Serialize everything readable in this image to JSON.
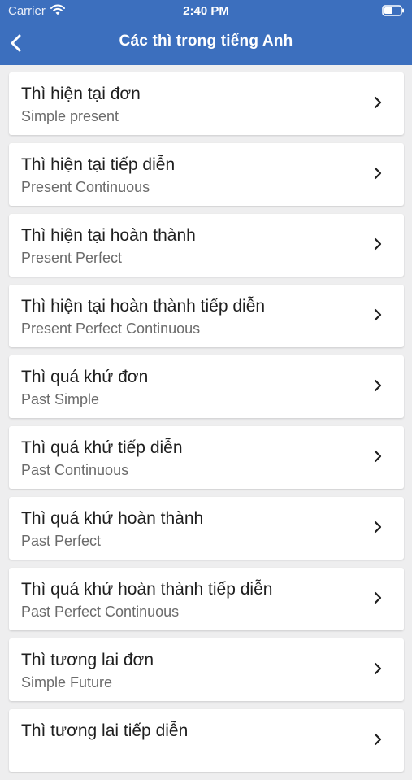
{
  "status_bar": {
    "carrier": "Carrier",
    "time": "2:40 PM",
    "icons": [
      "wifi-icon",
      "battery-icon"
    ]
  },
  "nav": {
    "title": "Các thì trong tiếng Anh",
    "back_icon": "chevron-left-icon"
  },
  "colors": {
    "header_bg": "#3c6fbe",
    "page_bg": "#eeeeef",
    "card_bg": "#ffffff",
    "title_text": "#1f1f1f",
    "subtitle_text": "#6b6b6b"
  },
  "tenses": [
    {
      "title": "Thì hiện tại đơn",
      "subtitle": "Simple present"
    },
    {
      "title": "Thì hiện tại tiếp diễn",
      "subtitle": "Present Continuous"
    },
    {
      "title": "Thì hiện tại hoàn thành",
      "subtitle": "Present Perfect"
    },
    {
      "title": "Thì hiện tại hoàn thành tiếp diễn",
      "subtitle": "Present Perfect Continuous"
    },
    {
      "title": "Thì quá khứ đơn",
      "subtitle": "Past Simple"
    },
    {
      "title": "Thì quá khứ tiếp diễn",
      "subtitle": "Past Continuous"
    },
    {
      "title": "Thì quá khứ hoàn thành",
      "subtitle": "Past Perfect"
    },
    {
      "title": "Thì quá khứ hoàn thành tiếp diễn",
      "subtitle": "Past Perfect Continuous"
    },
    {
      "title": "Thì tương lai đơn",
      "subtitle": "Simple Future"
    },
    {
      "title": "Thì tương lai tiếp diễn",
      "subtitle": ""
    }
  ]
}
